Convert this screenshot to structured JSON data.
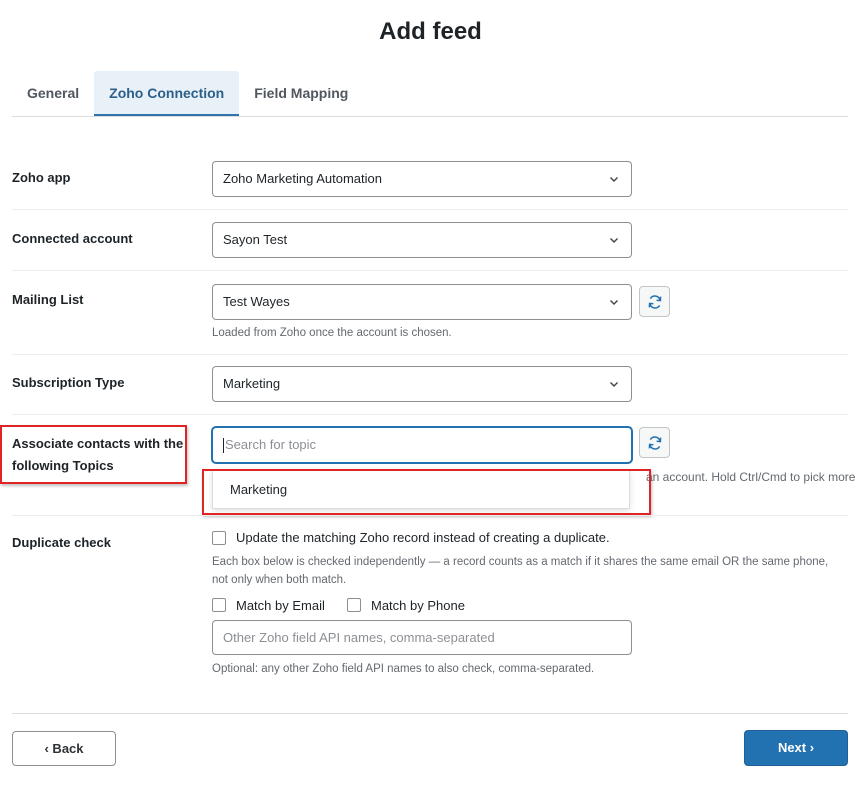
{
  "page": {
    "title": "Add feed"
  },
  "tabs": [
    {
      "label": "General",
      "active": false
    },
    {
      "label": "Zoho Connection",
      "active": true
    },
    {
      "label": "Field Mapping",
      "active": false
    }
  ],
  "fields": {
    "zoho_app": {
      "label": "Zoho app",
      "value": "Zoho Marketing Automation"
    },
    "connected_account": {
      "label": "Connected account",
      "value": "Sayon Test"
    },
    "mailing_list": {
      "label": "Mailing List",
      "value": "Test Wayes",
      "help": "Loaded from Zoho once the account is chosen."
    },
    "subscription_type": {
      "label": "Subscription Type",
      "value": "Marketing"
    },
    "topics": {
      "label_line1": "Associate contacts with the",
      "label_line2": "following Topics",
      "placeholder": "Search for topic",
      "help_partial": "an account. Hold Ctrl/Cmd to pick more",
      "options": [
        "Marketing"
      ]
    },
    "duplicate_check": {
      "label": "Duplicate check",
      "update_label": "Update the matching Zoho record instead of creating a duplicate.",
      "help_line1": "Each box below is checked independently — a record counts as a match if it shares the same email OR the same phone,",
      "help_line2": "not only when both match.",
      "match_email_label": "Match by Email",
      "match_phone_label": "Match by Phone",
      "other_fields_placeholder": "Other Zoho field API names, comma-separated",
      "other_fields_help": "Optional: any other Zoho field API names to also check, comma-separated."
    }
  },
  "footer": {
    "back_label": "‹ Back",
    "next_label": "Next ›"
  },
  "colors": {
    "primary": "#2271b1",
    "highlight_red": "#e02424",
    "active_tab_bg": "#e8f1f8"
  },
  "icons": {
    "select_arrow": "chevron-down-icon",
    "refresh": "refresh-icon"
  }
}
